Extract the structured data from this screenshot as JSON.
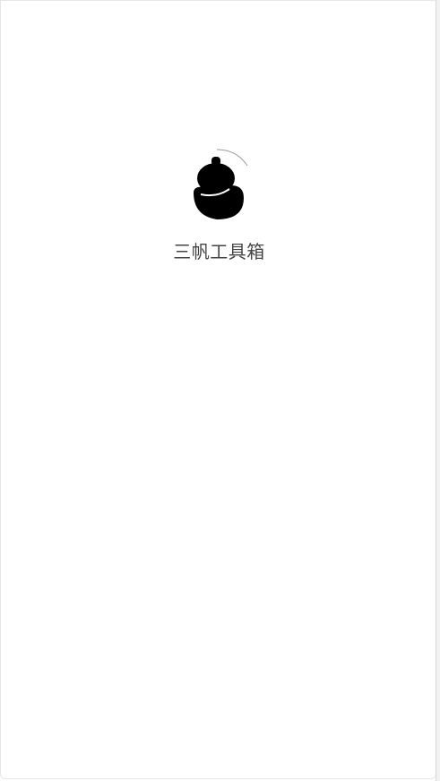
{
  "splash": {
    "app_name": "三帆工具箱",
    "logo_icon": "gourd-logo-icon"
  },
  "colors": {
    "background": "#ffffff",
    "logo": "#000000",
    "text": "#444444"
  }
}
